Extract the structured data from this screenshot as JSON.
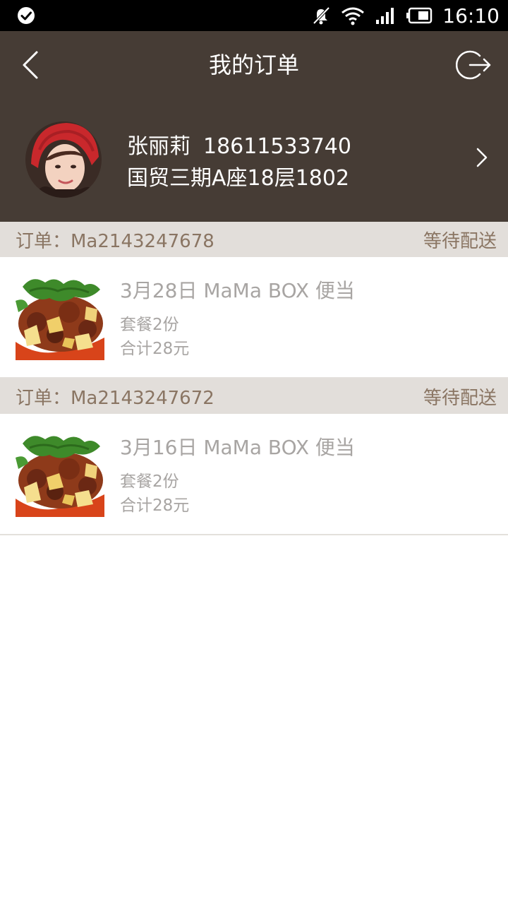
{
  "status_bar": {
    "time": "16:10",
    "icons": [
      "check-circle-icon",
      "mute-icon",
      "wifi-icon",
      "signal-icon",
      "battery-icon"
    ]
  },
  "header": {
    "title": "我的订单",
    "back_icon": "chevron-left-icon",
    "logout_icon": "logout-icon",
    "background": "#463c35"
  },
  "profile": {
    "name": "张丽莉",
    "phone": "18611533740",
    "address": "国贸三期A座18层1802",
    "arrow_icon": "chevron-right-icon"
  },
  "orders": [
    {
      "label": "订单：Ma2143247678",
      "status": "等待配送",
      "title": "3月28日 MaMa BOX 便当",
      "quantity": "套餐2份",
      "total": "合计28元"
    },
    {
      "label": "订单：Ma2143247672",
      "status": "等待配送",
      "title": "3月16日 MaMa BOX 便当",
      "quantity": "套餐2份",
      "total": "合计28元"
    }
  ],
  "colors": {
    "order_header_bg": "#e2deda",
    "order_header_text": "#8a7563",
    "order_text": "#a8a5a3"
  }
}
